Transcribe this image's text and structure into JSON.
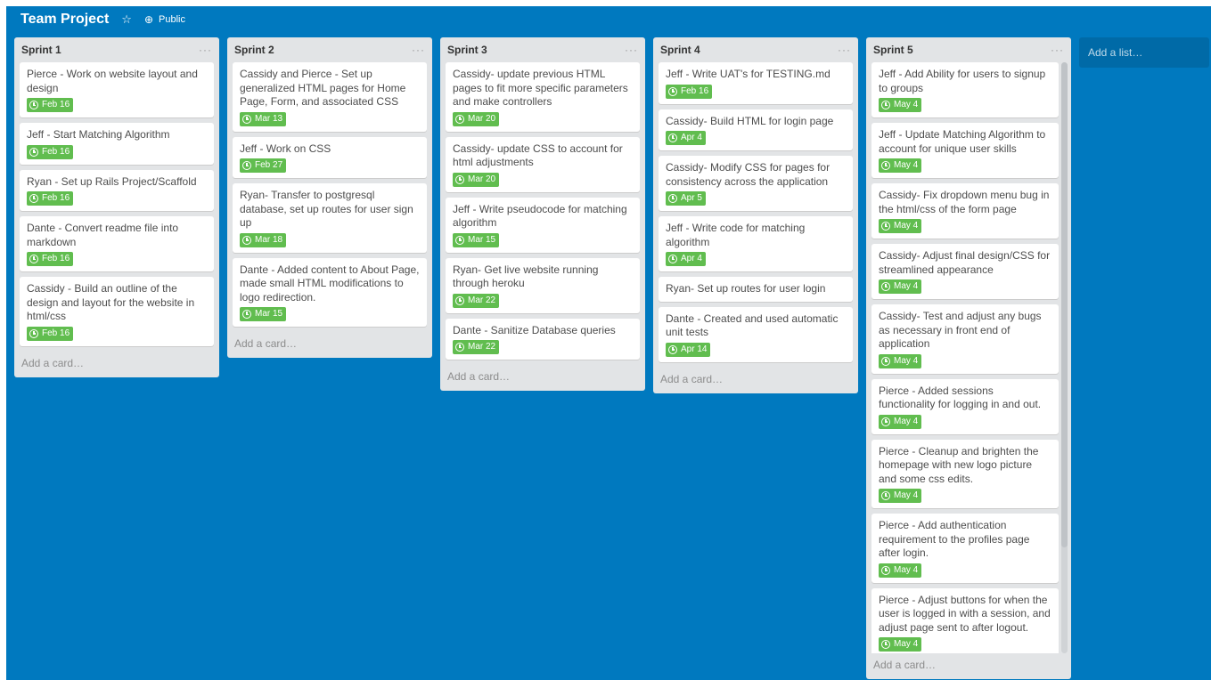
{
  "board": {
    "title": "Team Project",
    "visibility": "Public",
    "background": "#0079bf",
    "icons": [
      "star-icon",
      "globe-icon"
    ]
  },
  "add_list_label": "Add a list…",
  "add_card_label": "Add a card…",
  "badge_color": "#61bd4f",
  "lists": [
    {
      "name": "Sprint 1",
      "cards": [
        {
          "title": "Pierce - Work on website layout and design",
          "due": "Feb 16"
        },
        {
          "title": "Jeff - Start Matching Algorithm",
          "due": "Feb 16"
        },
        {
          "title": "Ryan - Set up Rails Project/Scaffold",
          "due": "Feb 16"
        },
        {
          "title": "Dante - Convert readme file into markdown",
          "due": "Feb 16"
        },
        {
          "title": "Cassidy - Build an outline of the design and layout for the website in html/css",
          "due": "Feb 16"
        }
      ]
    },
    {
      "name": "Sprint 2",
      "cards": [
        {
          "title": "Cassidy and Pierce - Set up generalized HTML pages for Home Page, Form, and associated CSS",
          "due": "Mar 13"
        },
        {
          "title": "Jeff - Work on CSS",
          "due": "Feb 27"
        },
        {
          "title": "Ryan- Transfer to postgresql database, set up routes for user sign up",
          "due": "Mar 18"
        },
        {
          "title": "Dante - Added content to About Page, made small HTML modifications to logo redirection.",
          "due": "Mar 15"
        }
      ]
    },
    {
      "name": "Sprint 3",
      "cards": [
        {
          "title": "Cassidy- update previous HTML pages to fit more specific parameters and make controllers",
          "due": "Mar 20"
        },
        {
          "title": "Cassidy- update CSS to account for html adjustments",
          "due": "Mar 20"
        },
        {
          "title": "Jeff - Write pseudocode for matching algorithm",
          "due": "Mar 15"
        },
        {
          "title": "Ryan- Get live website running through heroku",
          "due": "Mar 22"
        },
        {
          "title": "Dante - Sanitize Database queries",
          "due": "Mar 22"
        }
      ]
    },
    {
      "name": "Sprint 4",
      "cards": [
        {
          "title": "Jeff - Write UAT's for TESTING.md",
          "due": "Feb 16"
        },
        {
          "title": "Cassidy- Build HTML for login page",
          "due": "Apr 4"
        },
        {
          "title": "Cassidy- Modify CSS for pages for consistency across the application",
          "due": "Apr 5"
        },
        {
          "title": "Jeff - Write code for matching algorithm",
          "due": "Apr 4"
        },
        {
          "title": "Ryan- Set up routes for user login",
          "due": null
        },
        {
          "title": "Dante - Created and used automatic unit tests",
          "due": "Apr 14"
        }
      ]
    },
    {
      "name": "Sprint 5",
      "cards": [
        {
          "title": "Jeff - Add Ability for users to signup to groups",
          "due": "May 4"
        },
        {
          "title": "Jeff - Update Matching Algorithm to account for unique user skills",
          "due": "May 4"
        },
        {
          "title": "Cassidy- Fix dropdown menu bug in the html/css of the form page",
          "due": "May 4"
        },
        {
          "title": "Cassidy- Adjust final design/CSS for streamlined appearance",
          "due": "May 4"
        },
        {
          "title": "Cassidy- Test and adjust any bugs as necessary in front end of application",
          "due": "May 4"
        },
        {
          "title": "Pierce - Added sessions functionality for logging in and out.",
          "due": "May 4"
        },
        {
          "title": "Pierce - Cleanup and brighten the homepage with new logo picture and some css edits.",
          "due": "May 4"
        },
        {
          "title": "Pierce - Add authentication requirement to the profiles page after login.",
          "due": "May 4"
        },
        {
          "title": "Pierce - Adjust buttons for when the user is logged in with a session, and adjust page sent to after logout.",
          "due": "May 4"
        }
      ]
    }
  ]
}
